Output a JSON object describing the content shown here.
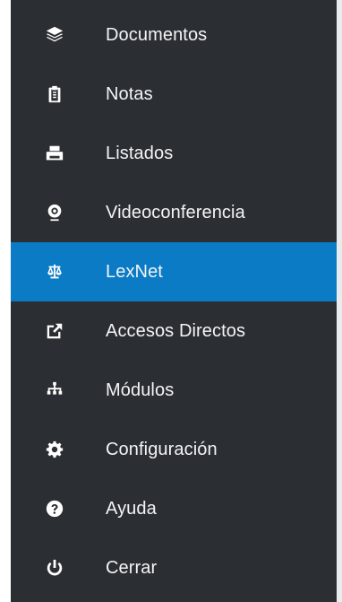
{
  "menu": {
    "items": [
      {
        "label": "Documentos",
        "icon": "layers-icon"
      },
      {
        "label": "Notas",
        "icon": "clipboard-icon"
      },
      {
        "label": "Listados",
        "icon": "printer-icon"
      },
      {
        "label": "Videoconferencia",
        "icon": "webcam-icon"
      },
      {
        "label": "LexNet",
        "icon": "balance-scale-icon",
        "active": true
      },
      {
        "label": "Accesos Directos",
        "icon": "external-link-icon"
      },
      {
        "label": "Módulos",
        "icon": "sitemap-icon"
      },
      {
        "label": "Configuración",
        "icon": "gear-icon"
      },
      {
        "label": "Ayuda",
        "icon": "question-circle-icon"
      },
      {
        "label": "Cerrar",
        "icon": "power-icon"
      }
    ]
  },
  "colors": {
    "sidebar_bg": "#2b2f33",
    "active_bg": "#0a7bc4",
    "text": "#f3f4f6"
  }
}
